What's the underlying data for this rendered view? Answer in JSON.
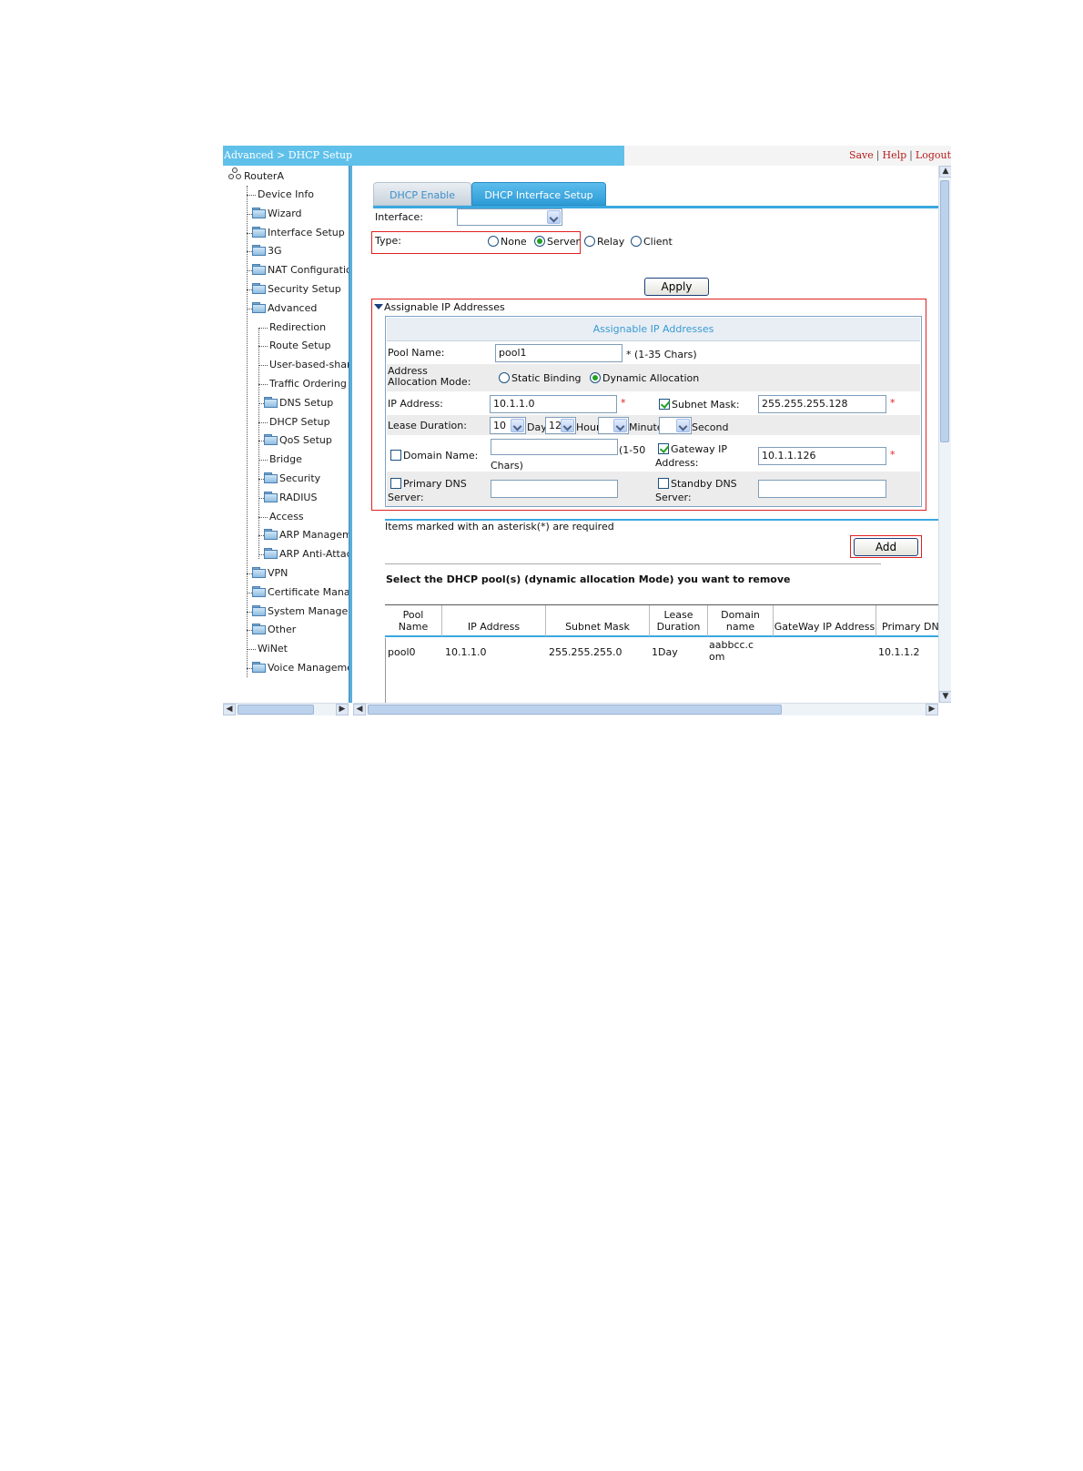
{
  "topbar": {
    "breadcrumb": "Advanced > DHCP Setup",
    "links": [
      "Save",
      "Help",
      "Logout"
    ],
    "separator": "|"
  },
  "tree": {
    "root": "RouterA",
    "items": [
      {
        "label": "Device Info",
        "folder": false,
        "level": 1
      },
      {
        "label": "Wizard",
        "folder": true,
        "level": 1
      },
      {
        "label": "Interface Setup",
        "folder": true,
        "level": 1
      },
      {
        "label": "3G",
        "folder": true,
        "level": 1
      },
      {
        "label": "NAT Configuration",
        "folder": true,
        "level": 1
      },
      {
        "label": "Security Setup",
        "folder": true,
        "level": 1
      },
      {
        "label": "Advanced",
        "folder": true,
        "level": 1
      },
      {
        "label": "Redirection",
        "folder": false,
        "level": 2
      },
      {
        "label": "Route Setup",
        "folder": false,
        "level": 2
      },
      {
        "label": "User-based-sharing",
        "folder": false,
        "level": 2
      },
      {
        "label": "Traffic Ordering",
        "folder": false,
        "level": 2
      },
      {
        "label": "DNS Setup",
        "folder": true,
        "level": 2
      },
      {
        "label": "DHCP Setup",
        "folder": false,
        "level": 2
      },
      {
        "label": "QoS Setup",
        "folder": true,
        "level": 2
      },
      {
        "label": "Bridge",
        "folder": false,
        "level": 2
      },
      {
        "label": "Security",
        "folder": true,
        "level": 2
      },
      {
        "label": "RADIUS",
        "folder": true,
        "level": 2
      },
      {
        "label": "Access",
        "folder": false,
        "level": 2
      },
      {
        "label": "ARP Management",
        "folder": true,
        "level": 2
      },
      {
        "label": "ARP Anti-Attack",
        "folder": true,
        "level": 2
      },
      {
        "label": "VPN",
        "folder": true,
        "level": 1
      },
      {
        "label": "Certificate Management",
        "folder": true,
        "level": 1
      },
      {
        "label": "System Management",
        "folder": true,
        "level": 1
      },
      {
        "label": "Other",
        "folder": true,
        "level": 1
      },
      {
        "label": "WiNet",
        "folder": false,
        "level": 1
      },
      {
        "label": "Voice Management",
        "folder": true,
        "level": 1
      }
    ]
  },
  "tabs": [
    "DHCP Enable",
    "DHCP Interface Setup"
  ],
  "interface": {
    "label": "Interface:",
    "value": ""
  },
  "type": {
    "label": "Type:",
    "options": [
      "None",
      "Server",
      "Relay",
      "Client"
    ],
    "selected": "Server"
  },
  "apply_label": "Apply",
  "section_title": "Assignable IP Addresses",
  "form": {
    "header": "Assignable IP Addresses",
    "pool_name_label": "Pool Name:",
    "pool_name_value": "pool1",
    "pool_name_hint": "* (1-35 Chars)",
    "alloc_mode_label": "Address Allocation Mode:",
    "alloc_static": "Static Binding",
    "alloc_dynamic": "Dynamic Allocation",
    "alloc_selected": "Dynamic Allocation",
    "ip_label": "IP Address:",
    "ip_value": "10.1.1.0",
    "mask_label": "Subnet Mask:",
    "mask_checked": true,
    "mask_value": "255.255.255.128",
    "lease_label": "Lease Duration:",
    "lease_day": "10",
    "lease_day_unit": "Day",
    "lease_hour": "12",
    "lease_hour_unit": "Hour",
    "lease_minute": "",
    "lease_minute_unit": "Minute",
    "lease_second": "",
    "lease_second_unit": "Second",
    "domain_label": "Domain Name:",
    "domain_checked": false,
    "domain_value": "",
    "domain_hint_1": "(1-50",
    "domain_hint_2": "Chars)",
    "gateway_label_1": "Gateway IP",
    "gateway_label_2": "Address:",
    "gateway_checked": true,
    "gateway_value": "10.1.1.126",
    "primary_dns_label_1": "Primary DNS",
    "primary_dns_label_2": "Server:",
    "primary_dns_checked": false,
    "primary_dns_value": "",
    "standby_dns_label_1": "Standby DNS",
    "standby_dns_label_2": "Server:",
    "standby_dns_checked": false,
    "standby_dns_value": "",
    "asterisk": "*"
  },
  "required_note": "Items marked with an asterisk(*) are required",
  "add_label": "Add",
  "remove_title": "Select the DHCP pool(s) (dynamic allocation Mode) you want to remove",
  "pool_table": {
    "columns": [
      [
        "Pool",
        "Name"
      ],
      [
        "IP Address"
      ],
      [
        "Subnet Mask"
      ],
      [
        "Lease",
        "Duration"
      ],
      [
        "Domain",
        "name"
      ],
      [
        "GateWay IP Address"
      ],
      [
        "Primary DNS"
      ]
    ],
    "rows": [
      [
        "pool0",
        "10.1.1.0",
        "255.255.255.0",
        "1Day",
        "aabbcc.com",
        "",
        "10.1.1.2"
      ]
    ]
  }
}
